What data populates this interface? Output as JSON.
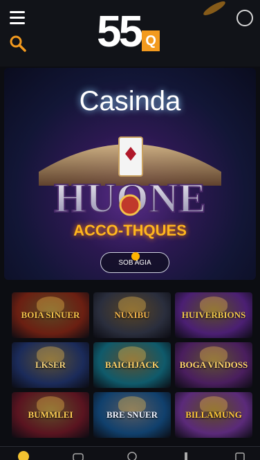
{
  "header": {
    "logo_number": "55",
    "logo_badge": "Q"
  },
  "hero": {
    "title": "Casinda",
    "art_text": "HUONE",
    "subtitle": "ACCO-THQUES",
    "button_label": "SOB AGIA"
  },
  "games": [
    {
      "label": "BOIA SINUER",
      "bg": "#6b1f12",
      "accent": "#f2c14b"
    },
    {
      "label": "NUXIBU",
      "bg": "#2a2e3d",
      "accent": "#f0b24a"
    },
    {
      "label": "HUIVERBIONS",
      "bg": "#4b1f73",
      "accent": "#f2c94c"
    },
    {
      "label": "LKSER",
      "bg": "#1b2b5a",
      "accent": "#f4d27a"
    },
    {
      "label": "BAICHJACK",
      "bg": "#0f5a6b",
      "accent": "#ffd36a"
    },
    {
      "label": "BOGA VINDOSS",
      "bg": "#4a1e5e",
      "accent": "#ffd56b"
    },
    {
      "label": "BUMMLEI",
      "bg": "#5a1420",
      "accent": "#ffcf55"
    },
    {
      "label": "BRE SNUER",
      "bg": "#10406d",
      "accent": "#f0f4ff"
    },
    {
      "label": "BILLAMUNG",
      "bg": "#5b2a7a",
      "accent": "#ffc93a"
    }
  ],
  "colors": {
    "accent": "#f39a1e",
    "header_bg": "#111318",
    "page_bg": "#0c0d12"
  }
}
